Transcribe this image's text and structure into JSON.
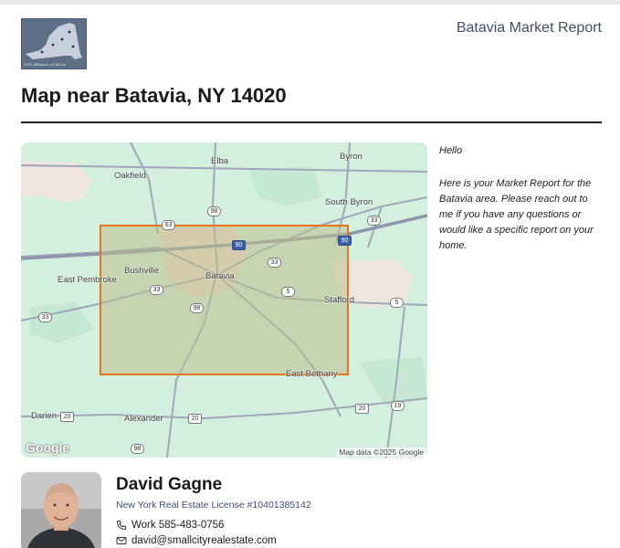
{
  "header": {
    "logo_caption": "NYS Alliance of MLSs",
    "report_title": "Batavia Market Report"
  },
  "page_title": "Map near Batavia, NY 14020",
  "map": {
    "place_labels": {
      "elba": "Elba",
      "byron": "Byron",
      "oakfield": "Oakfield",
      "south_byron": "South Byron",
      "bushville": "Bushville",
      "batavia": "Batavia",
      "east_pembroke": "East Pembroke",
      "stafford": "Stafford",
      "east_bethany": "East Bethany",
      "darien": "Darien",
      "alexander": "Alexander"
    },
    "route_shields": {
      "r63": "63",
      "r98_north": "98",
      "r90": "90",
      "r33_ne": "33",
      "r33_center": "33",
      "r33_west": "33",
      "r33_left": "33",
      "r5_center": "5",
      "r5_east": "5",
      "r98_south": "98",
      "r20_darien": "20",
      "r20_alexander": "20",
      "r20_east": "20",
      "r19": "19",
      "r98_bottom": "98",
      "r90_east": "90"
    },
    "google_logo_text": "Google",
    "attribution": "Map data ©2025 Google",
    "highlight_color": "#e8731f"
  },
  "message": {
    "greeting": "Hello",
    "body": "Here is your Market Report for the Batavia area. Please reach out to me if you have any questions or would like a specific report on your home."
  },
  "agent": {
    "name": "David Gagne",
    "license": "New York Real Estate License #10401385142",
    "work_phone": "Work 585-483-0756",
    "email": "david@smallcityrealestate.com"
  }
}
